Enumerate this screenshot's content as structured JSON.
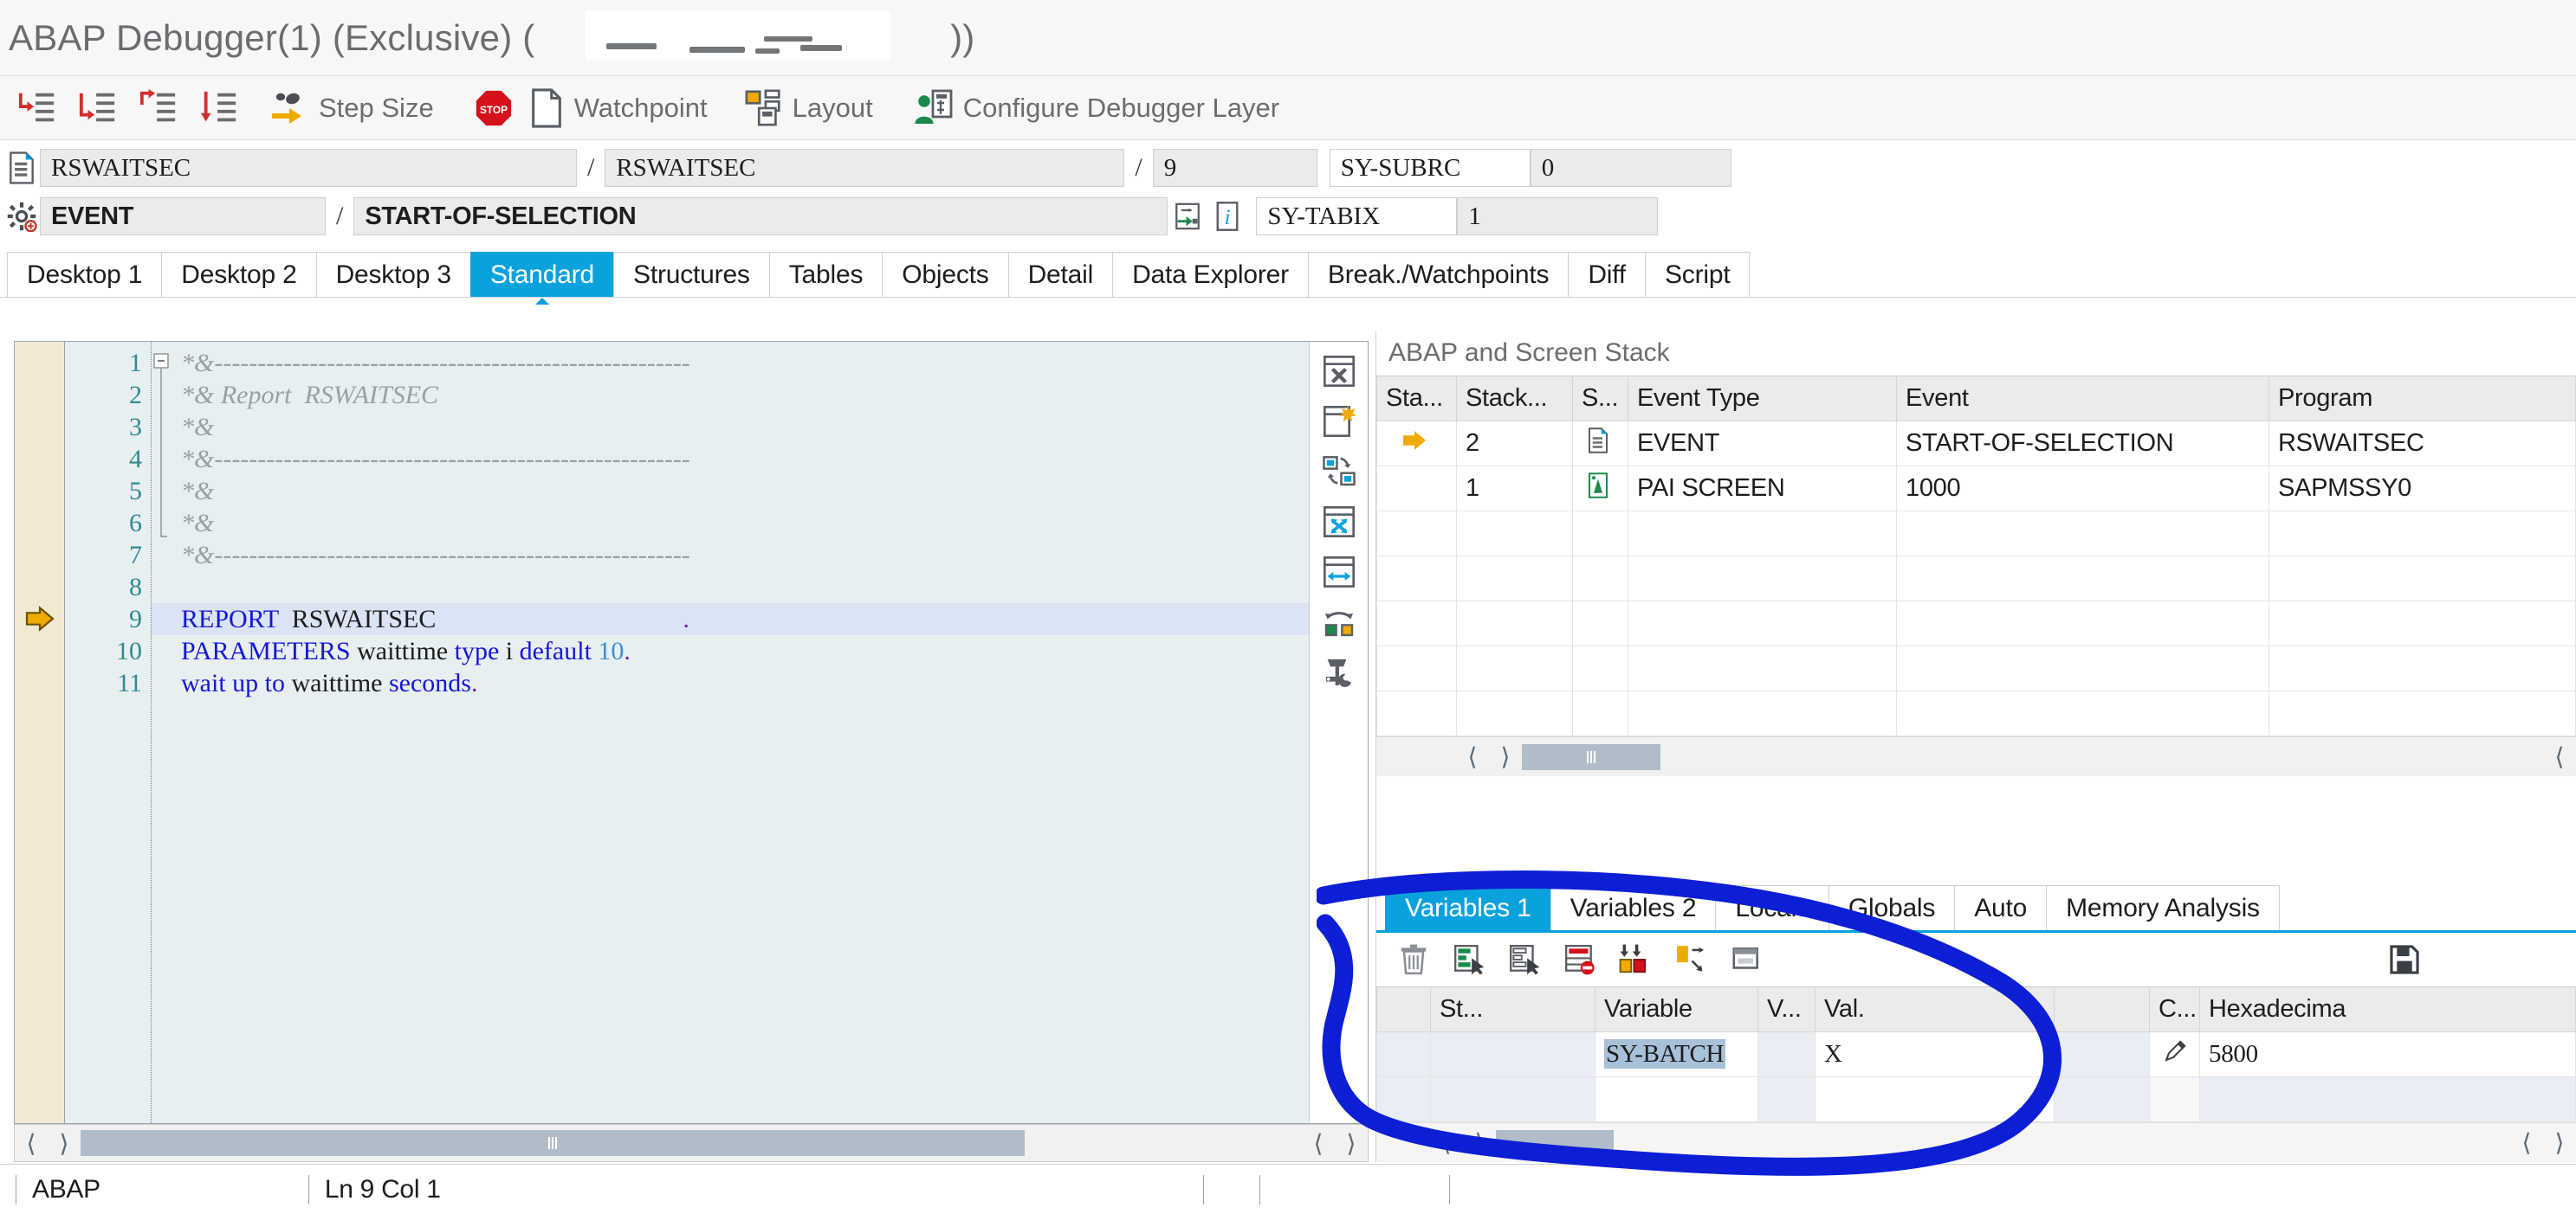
{
  "window": {
    "title": "ABAP Debugger(1)  (Exclusive) (",
    "title_suffix": "))",
    "title_redacted": true
  },
  "toolbar": {
    "buttons": [
      {
        "label": "",
        "icon": "step-into-icon"
      },
      {
        "label": "",
        "icon": "step-over-icon"
      },
      {
        "label": "",
        "icon": "step-return-icon"
      },
      {
        "label": "",
        "icon": "continue-icon"
      },
      {
        "label": "Step Size",
        "icon": "step-size-icon"
      },
      {
        "label": "Watchpoint",
        "icon": "watchpoint-icon"
      },
      {
        "label": "Layout",
        "icon": "layout-icon"
      },
      {
        "label": "Configure Debugger Layer",
        "icon": "configure-debugger-layer-icon"
      }
    ]
  },
  "fields": {
    "row1": {
      "icon": "program-icon",
      "program": "RSWAITSEC",
      "sep1": "/",
      "include": "RSWAITSEC",
      "sep2": "/",
      "line": "9",
      "subrc_label": "SY-SUBRC",
      "subrc_value": "0"
    },
    "row2": {
      "icon": "settings-icon",
      "event_type": "EVENT",
      "sep1": "/",
      "event": "START-OF-SELECTION",
      "goto_icon": "goto-icon",
      "info_icon": "info-icon",
      "tabix_label": "SY-TABIX",
      "tabix_value": "1"
    }
  },
  "tabs": {
    "items": [
      "Desktop 1",
      "Desktop 2",
      "Desktop 3",
      "Standard",
      "Structures",
      "Tables",
      "Objects",
      "Detail",
      "Data Explorer",
      "Break./Watchpoints",
      "Diff",
      "Script"
    ],
    "active": "Standard"
  },
  "editor": {
    "current_line": 9,
    "lines": [
      {
        "n": "1",
        "segments": [
          {
            "t": "*&-------------------------------------------------------",
            "c": "cmt"
          }
        ]
      },
      {
        "n": "2",
        "segments": [
          {
            "t": "*& Report  RSWAITSEC",
            "c": "cmt"
          }
        ]
      },
      {
        "n": "3",
        "segments": [
          {
            "t": "*&",
            "c": "cmt"
          }
        ]
      },
      {
        "n": "4",
        "segments": [
          {
            "t": "*&-------------------------------------------------------",
            "c": "cmt"
          }
        ]
      },
      {
        "n": "5",
        "segments": [
          {
            "t": "*&",
            "c": "cmt"
          }
        ]
      },
      {
        "n": "6",
        "segments": [
          {
            "t": "*&",
            "c": "cmt"
          }
        ]
      },
      {
        "n": "7",
        "segments": [
          {
            "t": "*&-------------------------------------------------------",
            "c": "cmt"
          }
        ]
      },
      {
        "n": "8",
        "segments": [
          {
            "t": "",
            "c": "plain"
          }
        ]
      },
      {
        "n": "9",
        "segments": [
          {
            "t": "REPORT",
            "c": "kw"
          },
          {
            "t": "  ",
            "c": "plain"
          },
          {
            "t": "RSWAITSEC",
            "c": "plain"
          },
          {
            "t": "                                      ",
            "c": "plain"
          },
          {
            "t": ".",
            "c": "dot"
          }
        ]
      },
      {
        "n": "10",
        "segments": [
          {
            "t": "PARAMETERS",
            "c": "kw"
          },
          {
            "t": " waittime ",
            "c": "plain"
          },
          {
            "t": "type",
            "c": "kw"
          },
          {
            "t": " i ",
            "c": "plain"
          },
          {
            "t": "default",
            "c": "kw"
          },
          {
            "t": " ",
            "c": "plain"
          },
          {
            "t": "10",
            "c": "num"
          },
          {
            "t": ".",
            "c": "dot"
          }
        ]
      },
      {
        "n": "11",
        "segments": [
          {
            "t": "wait",
            "c": "kw"
          },
          {
            "t": " ",
            "c": "plain"
          },
          {
            "t": "up",
            "c": "kw"
          },
          {
            "t": " ",
            "c": "plain"
          },
          {
            "t": "to",
            "c": "kw"
          },
          {
            "t": " waittime ",
            "c": "plain"
          },
          {
            "t": "seconds",
            "c": "kw"
          },
          {
            "t": ".",
            "c": "dot"
          }
        ]
      }
    ],
    "side_icons": [
      "close-window-icon",
      "new-window-icon",
      "swap-windows-icon",
      "maximize-icon",
      "resize-width-icon",
      "toggle-colors-icon",
      "tools-icon"
    ]
  },
  "stack": {
    "header": "ABAP and Screen Stack",
    "columns": [
      "Sta...",
      "Stack...",
      "S...",
      "Event Type",
      "Event",
      "Program"
    ],
    "rows": [
      {
        "status": "current-arrow-icon",
        "stack": "2",
        "s_icon": "program-icon",
        "event_type": "EVENT",
        "event": "START-OF-SELECTION",
        "program": "RSWAITSEC"
      },
      {
        "status": "",
        "stack": "1",
        "s_icon": "screen-icon",
        "event_type": "PAI SCREEN",
        "event": "1000",
        "program": "SAPMSSY0"
      }
    ],
    "empty_rows": 5
  },
  "variables": {
    "tabs": [
      "Variables 1",
      "Variables 2",
      "Locals",
      "Globals",
      "Auto",
      "Memory Analysis"
    ],
    "active_tab": "Variables 1",
    "toolbar_icons": [
      "delete-icon",
      "insert-row-icon",
      "copy-row-icon",
      "delete-row-icon",
      "sort-icon",
      "move-icon",
      "paste-icon",
      "save-icon"
    ],
    "columns": [
      "St...",
      "Variable",
      "V...",
      "Val.",
      "",
      "C...",
      "Hexadecima"
    ],
    "rows": [
      {
        "st": "",
        "variable": "SY-BATCH",
        "v": "",
        "val": "X",
        "spacer": "",
        "c": "edit-pencil-icon",
        "hex": "5800",
        "selected": true
      },
      {
        "st": "",
        "variable": "",
        "v": "",
        "val": "",
        "spacer": "",
        "c": "",
        "hex": ""
      }
    ]
  },
  "statusbar": {
    "language": "ABAP",
    "position": "Ln  9 Col  1"
  },
  "annotation": {
    "type": "hand-drawn-ellipse",
    "color": "#0d1fd4"
  },
  "colors": {
    "accent": "#0aa2dd",
    "toolbar_text": "#6a6d70",
    "code_bg": "#e8eff1",
    "highlight_line": "#dbe4f5",
    "annotation": "#0d1fd4"
  }
}
